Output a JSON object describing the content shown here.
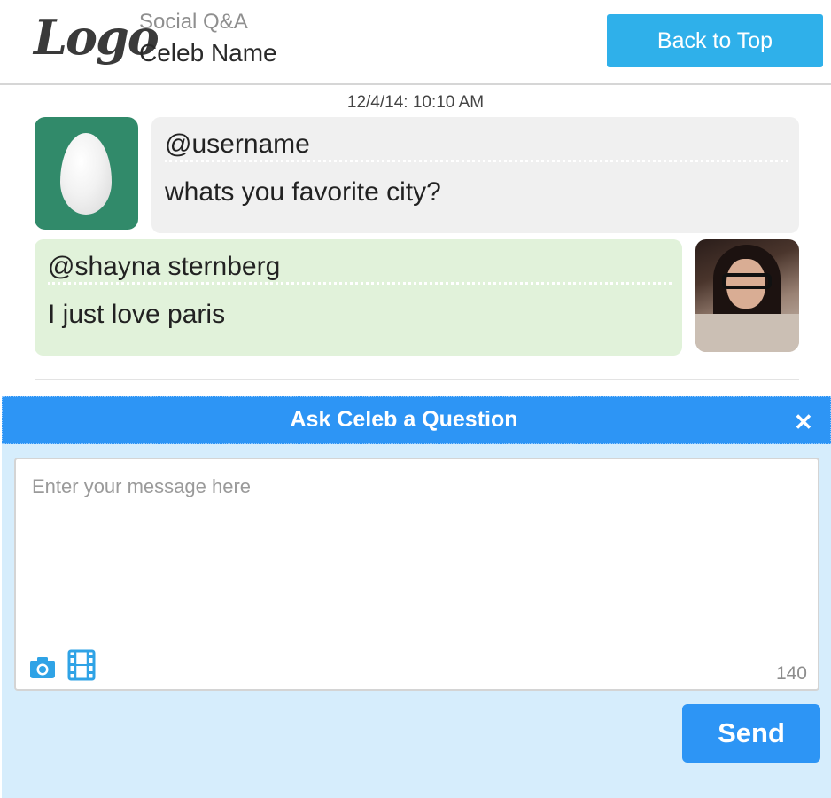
{
  "header": {
    "logo_text": "Logo",
    "subtitle": "Social Q&A",
    "celeb_name": "Celeb Name",
    "back_to_top_label": "Back to Top"
  },
  "conversation": {
    "timestamp": "12/4/14: 10:10 AM",
    "question": {
      "handle": "@username",
      "text": "whats you favorite city?"
    },
    "answer": {
      "handle": "@shayna sternberg",
      "text": "I just love paris"
    }
  },
  "ask_panel": {
    "title": "Ask Celeb a Question",
    "close_icon": "close-icon",
    "message_placeholder": "Enter your message here",
    "char_count": "140",
    "send_label": "Send"
  },
  "colors": {
    "accent": "#2d95f5",
    "back_to_top": "#2fb0ea",
    "question_bubble": "#f0f0f0",
    "answer_bubble": "#e1f2da",
    "panel_bg": "#d6edfc",
    "egg_avatar_bg": "#318a6a"
  },
  "icons": [
    "camera-icon",
    "film-icon",
    "close-icon"
  ]
}
